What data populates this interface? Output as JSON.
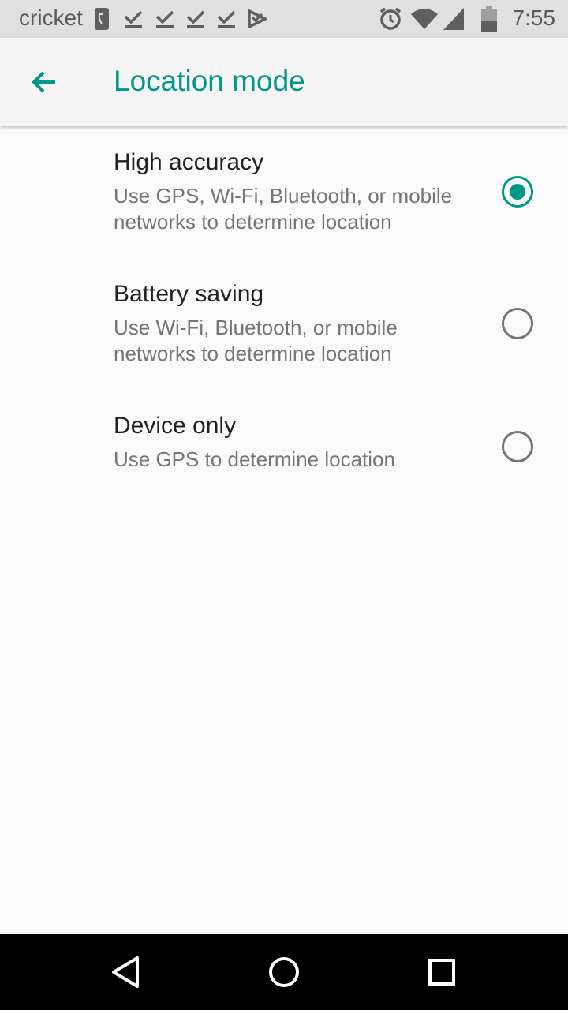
{
  "status_bar": {
    "carrier": "cricket",
    "time": "7:55",
    "icons": [
      "sim-icon",
      "check-icon",
      "check-icon",
      "check-icon",
      "check-icon",
      "play-store-icon",
      "alarm-icon",
      "wifi-icon",
      "signal-icon",
      "battery-icon"
    ]
  },
  "app_bar": {
    "back_icon": "arrow-back-icon",
    "title": "Location mode",
    "accent_color": "#009688"
  },
  "options": [
    {
      "title": "High accuracy",
      "summary_lines": [
        "Use GPS, Wi-Fi, Bluetooth, or mobile",
        "networks to determine location"
      ],
      "selected": true
    },
    {
      "title": "Battery saving",
      "summary_lines": [
        "Use Wi-Fi, Bluetooth, or mobile",
        "networks to determine location"
      ],
      "selected": false
    },
    {
      "title": "Device only",
      "summary_lines": [
        "Use GPS to determine location"
      ],
      "selected": false
    }
  ],
  "nav_bar": {
    "icons": [
      "back-triangle-icon",
      "home-circle-icon",
      "recents-square-icon"
    ]
  }
}
